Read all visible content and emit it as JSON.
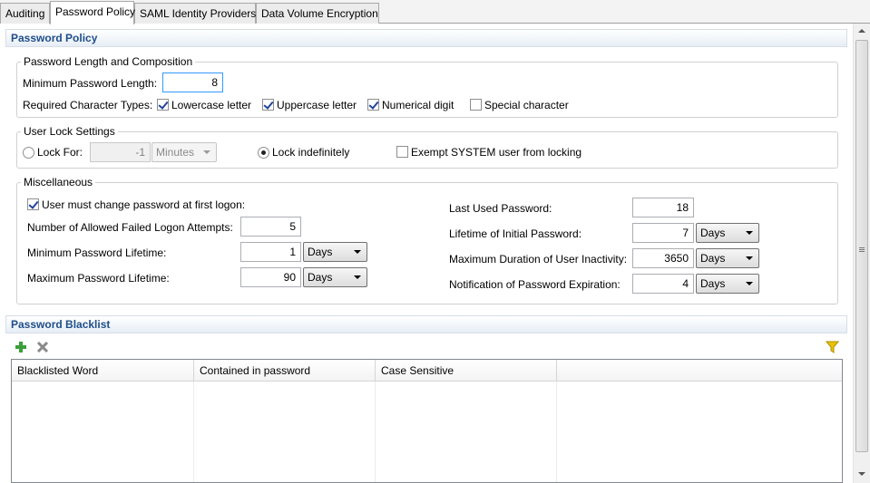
{
  "tabs": [
    {
      "label": "Auditing"
    },
    {
      "label": "Password Policy"
    },
    {
      "label": "SAML Identity Providers"
    },
    {
      "label": "Data Volume Encryption"
    }
  ],
  "password_policy": {
    "header": "Password Policy",
    "composition": {
      "title": "Password Length and Composition",
      "min_length_label": "Minimum Password Length:",
      "min_length_value": "8",
      "char_types_label": "Required Character Types:",
      "char_types": [
        {
          "label": "Lowercase letter",
          "checked": true
        },
        {
          "label": "Uppercase letter",
          "checked": true
        },
        {
          "label": "Numerical digit",
          "checked": true
        },
        {
          "label": "Special character",
          "checked": false
        }
      ]
    },
    "user_lock": {
      "title": "User Lock Settings",
      "lock_for_label": "Lock For:",
      "lock_for_value": "-1",
      "lock_for_unit": "Minutes",
      "lock_indefinitely_label": "Lock indefinitely",
      "exempt_label": "Exempt SYSTEM user from locking"
    },
    "misc": {
      "title": "Miscellaneous",
      "change_at_first_logon_label": "User must change password at first logon:",
      "failed_attempts_label": "Number of Allowed Failed Logon Attempts:",
      "failed_attempts_value": "5",
      "min_lifetime_label": "Minimum Password Lifetime:",
      "min_lifetime_value": "1",
      "min_lifetime_unit": "Days",
      "max_lifetime_label": "Maximum Password Lifetime:",
      "max_lifetime_value": "90",
      "max_lifetime_unit": "Days",
      "last_used_label": "Last Used Password:",
      "last_used_value": "18",
      "initial_lifetime_label": "Lifetime of Initial Password:",
      "initial_lifetime_value": "7",
      "initial_lifetime_unit": "Days",
      "max_inactivity_label": "Maximum Duration of User Inactivity:",
      "max_inactivity_value": "3650",
      "max_inactivity_unit": "Days",
      "notification_label": "Notification of Password Expiration:",
      "notification_value": "4",
      "notification_unit": "Days"
    }
  },
  "blacklist": {
    "header": "Password Blacklist",
    "columns": [
      "Blacklisted Word",
      "Contained in password",
      "Case Sensitive"
    ]
  },
  "colors": {
    "header_text": "#1f4e89",
    "add_icon": "#3aa03a",
    "filter_icon": "#e8c400"
  }
}
